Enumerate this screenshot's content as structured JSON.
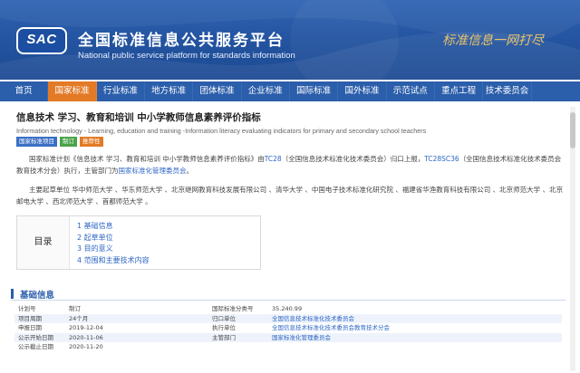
{
  "header": {
    "logo": "SAC",
    "title_cn": "全国标准信息公共服务平台",
    "title_en": "National public service platform  for standards information",
    "slogan": "标准信息一网打尽"
  },
  "nav": {
    "items": [
      "首页",
      "国家标准",
      "行业标准",
      "地方标准",
      "团体标准",
      "企业标准",
      "国际标准",
      "国外标准",
      "示范试点",
      "重点工程",
      "技术委员会"
    ],
    "active_index": 1
  },
  "standard": {
    "title": "信息技术 学习、教育和培训 中小学教师信息素养评价指标",
    "title_en": "Information technology - Learning, education and training -Information literacy evaluating indicators for primary and secondary school teachers",
    "badges": [
      "国家标准项目",
      "制订",
      "推荐性"
    ]
  },
  "intro": {
    "p1_a": "国家标准计划《信息技术 学习、教育和培训 中小学教师信息素养评价指标》由",
    "p1_link1": "TC28",
    "p1_b": "（全国信息技术标准化技术委员会）归口上报，",
    "p1_link2": "TC28SC36",
    "p1_c": "（全国信息技术标准化技术委员会教育技术分会）执行，主管部门为",
    "p1_link3": "国家标准化管理委员会",
    "p1_d": "。",
    "p2": "主要起草单位 华中师范大学 、华东师范大学 、北京继网教育科技发展有限公司 、清华大学 、中国电子技术标准化研究院 、福建省华渔教育科技有限公司 、北京师范大学 、北京邮电大学 、西北师范大学 、首都师范大学 。"
  },
  "toc": {
    "label": "目录",
    "items": [
      "1  基础信息",
      "2  起草单位",
      "3  目的意义",
      "4  范围和主要技术内容"
    ]
  },
  "basic_info": {
    "title": "基础信息",
    "rows": [
      {
        "k1": "计划号",
        "v1": "制订",
        "k2": "国际标准分类号",
        "v2": "35.240.99",
        "link": false
      },
      {
        "k1": "项目周期",
        "v1": "24个月",
        "k2": "归口单位",
        "v2": "全国信息技术标准化技术委员会",
        "link": true
      },
      {
        "k1": "申报日期",
        "v1": "2019-12-04",
        "k2": "执行单位",
        "v2": "全国信息技术标准化技术委员会教育技术分会",
        "link": true
      },
      {
        "k1": "公示开始日期",
        "v1": "2020-11-06",
        "k2": "主管部门",
        "v2": "国家标准化管理委员会",
        "link": true
      },
      {
        "k1": "公示截止日期",
        "v1": "2020-11-20",
        "k2": "",
        "v2": "",
        "link": false
      }
    ]
  },
  "colors": {
    "nav_bg": "#2b5eab",
    "nav_active": "#e37a26",
    "link": "#2d66c5"
  }
}
